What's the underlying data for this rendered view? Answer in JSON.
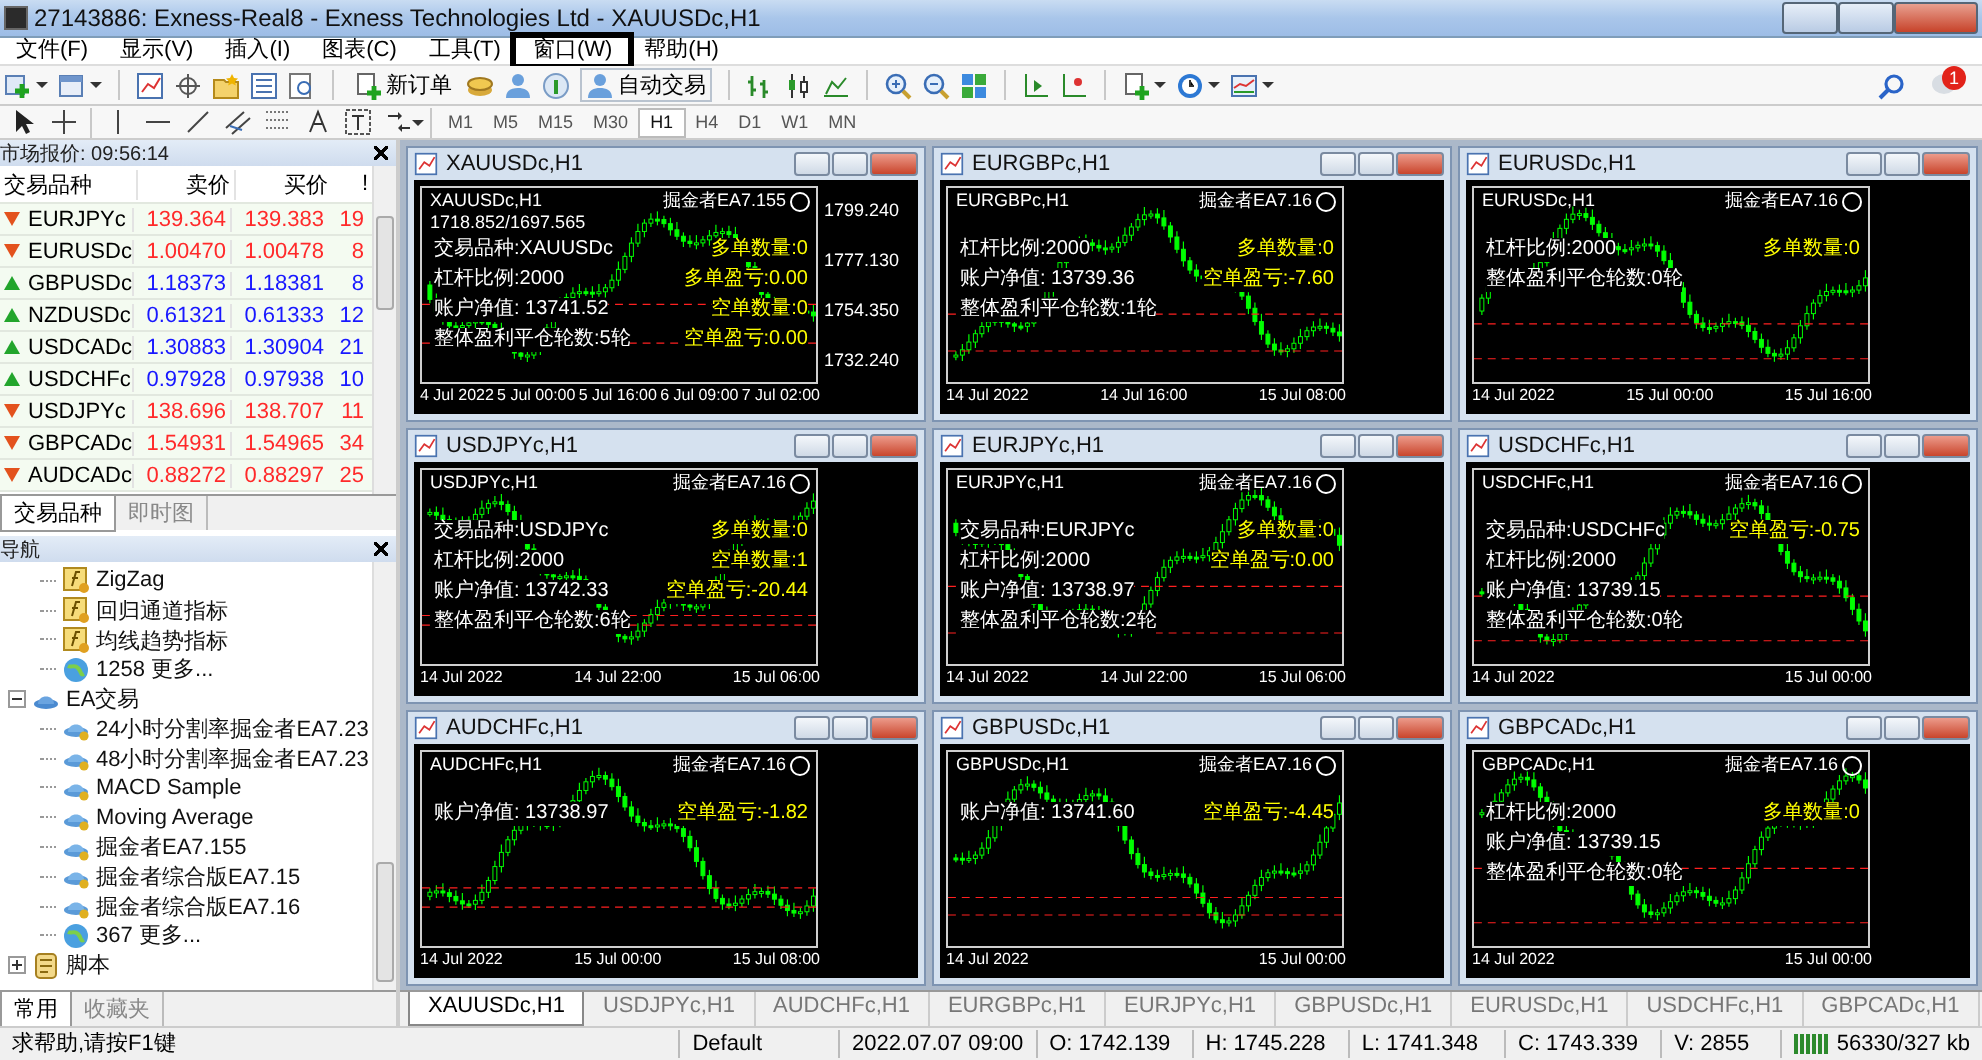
{
  "window": {
    "title": "27143886: Exness-Real8 - Exness Technologies Ltd - XAUUSDc,H1"
  },
  "menu": [
    {
      "label": "文件(F)",
      "boxed": false
    },
    {
      "label": "显示(V)",
      "boxed": false
    },
    {
      "label": "插入(I)",
      "boxed": false
    },
    {
      "label": "图表(C)",
      "boxed": false
    },
    {
      "label": "工具(T)",
      "boxed": false
    },
    {
      "label": "窗口(W)",
      "boxed": true
    },
    {
      "label": "帮助(H)",
      "boxed": false
    }
  ],
  "toolbar": {
    "new_order": "新订单",
    "auto_trading": "自动交易",
    "notification_count": "1"
  },
  "timeframes": [
    {
      "label": "M1",
      "selected": false
    },
    {
      "label": "M5",
      "selected": false
    },
    {
      "label": "M15",
      "selected": false
    },
    {
      "label": "M30",
      "selected": false
    },
    {
      "label": "H1",
      "selected": true
    },
    {
      "label": "H4",
      "selected": false
    },
    {
      "label": "D1",
      "selected": false
    },
    {
      "label": "W1",
      "selected": false
    },
    {
      "label": "MN",
      "selected": false
    }
  ],
  "market_watch": {
    "title": "市场报价: 09:56:14",
    "columns": [
      "交易品种",
      "卖价",
      "买价",
      "!"
    ],
    "rows": [
      {
        "symbol": "EURJPYc",
        "bid": "139.364",
        "ask": "139.383",
        "spread": "19",
        "rising": false
      },
      {
        "symbol": "EURUSDc",
        "bid": "1.00470",
        "ask": "1.00478",
        "spread": "8",
        "rising": false
      },
      {
        "symbol": "GBPUSDc",
        "bid": "1.18373",
        "ask": "1.18381",
        "spread": "8",
        "rising": true
      },
      {
        "symbol": "NZDUSDc",
        "bid": "0.61321",
        "ask": "0.61333",
        "spread": "12",
        "rising": true
      },
      {
        "symbol": "USDCADc",
        "bid": "1.30883",
        "ask": "1.30904",
        "spread": "21",
        "rising": true
      },
      {
        "symbol": "USDCHFc",
        "bid": "0.97928",
        "ask": "0.97938",
        "spread": "10",
        "rising": true
      },
      {
        "symbol": "USDJPYc",
        "bid": "138.696",
        "ask": "138.707",
        "spread": "11",
        "rising": false
      },
      {
        "symbol": "GBPCADc",
        "bid": "1.54931",
        "ask": "1.54965",
        "spread": "34",
        "rising": false
      },
      {
        "symbol": "AUDCADc",
        "bid": "0.88272",
        "ask": "0.88297",
        "spread": "25",
        "rising": false
      }
    ],
    "tabs": [
      {
        "label": "交易品种",
        "selected": true
      },
      {
        "label": "即时图",
        "selected": false
      }
    ]
  },
  "navigator": {
    "title": "导航",
    "items": [
      {
        "label": "ZigZag",
        "kind": "indicator"
      },
      {
        "label": "回归通道指标",
        "kind": "indicator"
      },
      {
        "label": "均线趋势指标",
        "kind": "indicator"
      },
      {
        "label": "1258 更多...",
        "kind": "more"
      },
      {
        "label": "EA交易",
        "kind": "folder",
        "expanded": true,
        "children": [
          {
            "label": "24小时分割率掘金者EA7.23",
            "kind": "expert"
          },
          {
            "label": "48小时分割率掘金者EA7.23",
            "kind": "expert"
          },
          {
            "label": "MACD Sample",
            "kind": "expert"
          },
          {
            "label": "Moving Average",
            "kind": "expert"
          },
          {
            "label": "掘金者EA7.155",
            "kind": "expert"
          },
          {
            "label": "掘金者综合版EA7.15",
            "kind": "expert"
          },
          {
            "label": "掘金者综合版EA7.16",
            "kind": "expert"
          },
          {
            "label": "367 更多...",
            "kind": "more"
          }
        ]
      },
      {
        "label": "脚本",
        "kind": "scripts",
        "expanded": false
      }
    ],
    "tabs": [
      {
        "label": "常用",
        "selected": true
      },
      {
        "label": "收藏夹",
        "selected": false
      }
    ]
  },
  "charts": [
    {
      "title": "XAUUSDc,H1",
      "header": "XAUUSDc,H1",
      "quote": "1718.852/1697.565",
      "ea": "掘金者EA7.155",
      "account_info": [
        "交易品种:XAUUSDc",
        "杠杆比例:2000",
        "账户净值: 13741.52",
        "整体盈利平仓轮数:5轮"
      ],
      "order_info": [
        "多单数量:0",
        "多单盈亏:0.00",
        "空单数量:0",
        "空单盈亏:0.00"
      ],
      "price_ticks": [
        "1799.240",
        "1777.130",
        "1754.350",
        "1732.240"
      ],
      "time_ticks": [
        "4 Jul 2022",
        "5 Jul 00:00",
        "5 Jul 16:00",
        "6 Jul 09:00",
        "7 Jul 02:00"
      ]
    },
    {
      "title": "EURGBPc,H1",
      "header": "EURGBPc,H1",
      "ea": "掘金者EA7.16",
      "account_info": [
        "杠杆比例:2000",
        "账户净值: 13739.36",
        "整体盈利平仓轮数:1轮"
      ],
      "order_info": [
        "多单数量:0",
        "空单盈亏:-7.60"
      ],
      "time_ticks": [
        "14 Jul 2022",
        "14 Jul 16:00",
        "15 Jul 08:00"
      ]
    },
    {
      "title": "EURUSDc,H1",
      "header": "EURUSDc,H1",
      "ea": "掘金者EA7.16",
      "account_info": [
        "杠杆比例:2000",
        "整体盈利平仓轮数:0轮"
      ],
      "order_info": [
        "多单数量:0"
      ],
      "time_ticks": [
        "14 Jul 2022",
        "15 Jul 00:00",
        "15 Jul 16:00"
      ]
    },
    {
      "title": "USDJPYc,H1",
      "header": "USDJPYc,H1",
      "ea": "掘金者EA7.16",
      "account_info": [
        "交易品种:USDJPYc",
        "杠杆比例:2000",
        "账户净值: 13742.33",
        "整体盈利平仓轮数:6轮"
      ],
      "order_info": [
        "多单数量:0",
        "空单数量:1",
        "空单盈亏:-20.44"
      ],
      "time_ticks": [
        "14 Jul 2022",
        "14 Jul 22:00",
        "15 Jul 06:00"
      ]
    },
    {
      "title": "EURJPYc,H1",
      "header": "EURJPYc,H1",
      "ea": "掘金者EA7.16",
      "account_info": [
        "交易品种:EURJPYc",
        "杠杆比例:2000",
        "账户净值: 13738.97",
        "整体盈利平仓轮数:2轮"
      ],
      "order_info": [
        "多单数量:0",
        "空单盈亏:0.00"
      ],
      "time_ticks": [
        "14 Jul 2022",
        "14 Jul 22:00",
        "15 Jul 06:00"
      ]
    },
    {
      "title": "USDCHFc,H1",
      "header": "USDCHFc,H1",
      "ea": "掘金者EA7.16",
      "account_info": [
        "交易品种:USDCHFc",
        "杠杆比例:2000",
        "账户净值: 13739.15",
        "整体盈利平仓轮数:0轮"
      ],
      "order_info": [
        "空单盈亏:-0.75"
      ],
      "time_ticks": [
        "14 Jul 2022",
        "15 Jul 00:00"
      ]
    },
    {
      "title": "AUDCHFc,H1",
      "header": "AUDCHFc,H1",
      "ea": "掘金者EA7.16",
      "account_info": [
        "账户净值: 13738.97"
      ],
      "order_info": [
        "空单盈亏:-1.82"
      ],
      "time_ticks": [
        "14 Jul 2022",
        "15 Jul 00:00",
        "15 Jul 08:00"
      ]
    },
    {
      "title": "GBPUSDc,H1",
      "header": "GBPUSDc,H1",
      "ea": "掘金者EA7.16",
      "account_info": [
        "账户净值: 13741.60"
      ],
      "order_info": [
        "空单盈亏:-4.45"
      ],
      "time_ticks": [
        "14 Jul 2022",
        "15 Jul 00:00"
      ]
    },
    {
      "title": "GBPCADc,H1",
      "header": "GBPCADc,H1",
      "ea": "掘金者EA7.16",
      "account_info": [
        "杠杆比例:2000",
        "账户净值: 13739.15",
        "整体盈利平仓轮数:0轮"
      ],
      "order_info": [
        "多单数量:0"
      ],
      "time_ticks": [
        "14 Jul 2022",
        "15 Jul 00:00"
      ]
    }
  ],
  "chart_tabs": [
    {
      "label": "XAUUSDc,H1",
      "selected": true
    },
    {
      "label": "USDJPYc,H1",
      "selected": false
    },
    {
      "label": "AUDCHFc,H1",
      "selected": false
    },
    {
      "label": "EURGBPc,H1",
      "selected": false
    },
    {
      "label": "EURJPYc,H1",
      "selected": false
    },
    {
      "label": "GBPUSDc,H1",
      "selected": false
    },
    {
      "label": "EURUSDc,H1",
      "selected": false
    },
    {
      "label": "USDCHFc,H1",
      "selected": false
    },
    {
      "label": "GBPCADc,H1",
      "selected": false
    }
  ],
  "status_bar": {
    "help": "求帮助,请按F1键",
    "profile": "Default",
    "time": "2022.07.07 09:00",
    "open": "O: 1742.139",
    "high": "H: 1745.228",
    "low": "L: 1741.348",
    "close": "C: 1743.339",
    "volume": "V: 2855",
    "traffic": "56330/327 kb"
  }
}
